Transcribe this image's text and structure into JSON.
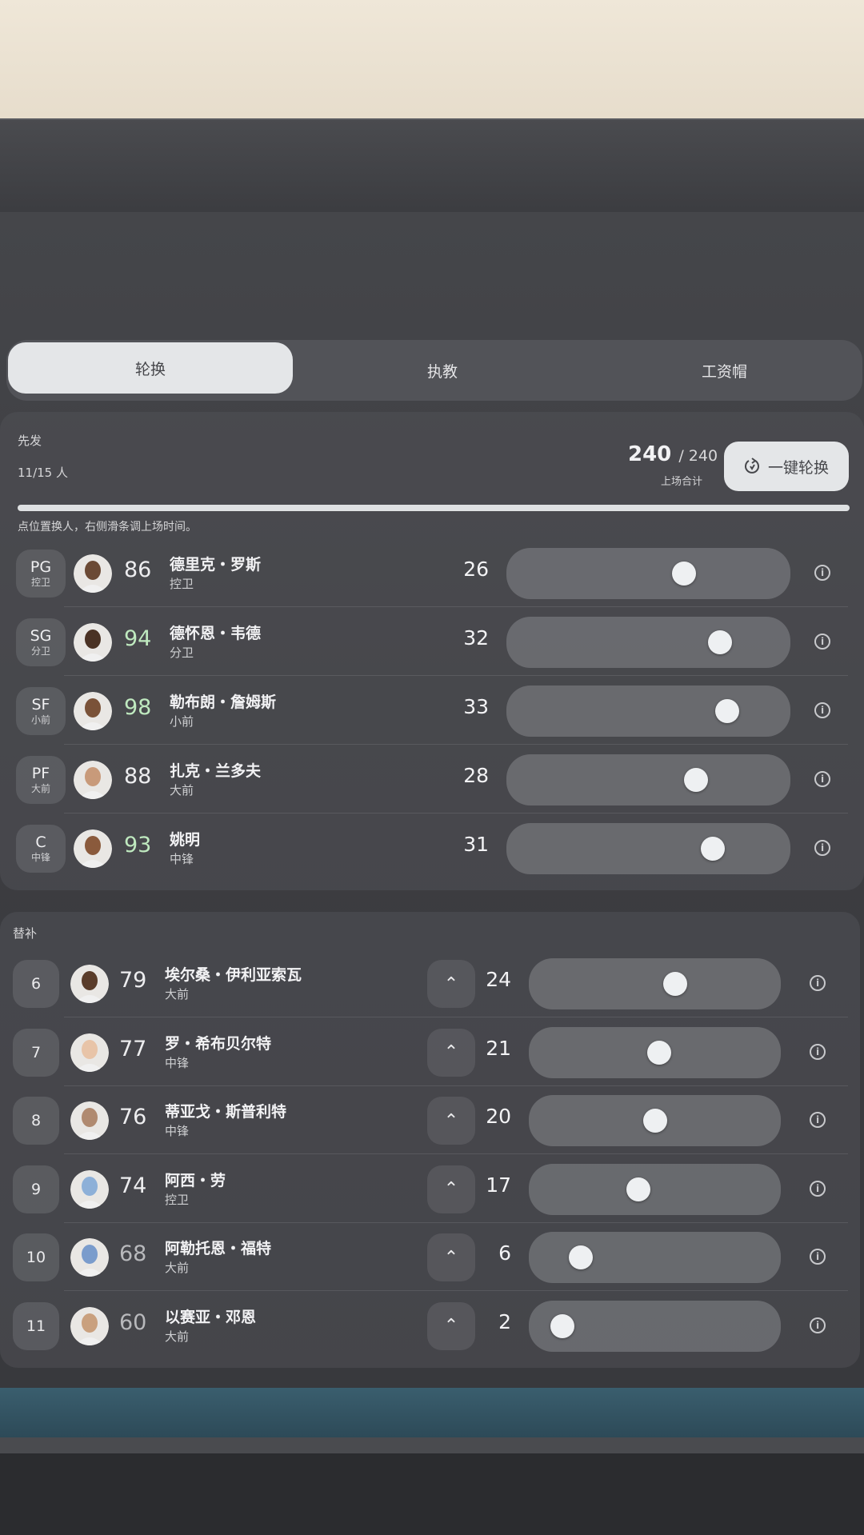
{
  "tabs": [
    {
      "label": "轮换"
    },
    {
      "label": "执教"
    },
    {
      "label": "工资帽"
    }
  ],
  "starters": {
    "title": "先发",
    "count": "11/15 人",
    "total_value": "240",
    "total_max": "/ 240",
    "total_label": "上场合计",
    "rotate_button": "一键轮换",
    "hint": "点位置换人，右侧滑条调上场时间。",
    "players": [
      {
        "pos": "PG",
        "pos_zh": "控卫",
        "ovr": "86",
        "name": "德里克・罗斯",
        "npos": "控卫",
        "mins": "26",
        "level": 0.65
      },
      {
        "pos": "SG",
        "pos_zh": "分卫",
        "ovr": "94",
        "name": "德怀恩・韦德",
        "npos": "分卫",
        "mins": "32",
        "level": 0.8
      },
      {
        "pos": "SF",
        "pos_zh": "小前",
        "ovr": "98",
        "name": "勒布朗・詹姆斯",
        "npos": "小前",
        "mins": "33",
        "level": 0.83
      },
      {
        "pos": "PF",
        "pos_zh": "大前",
        "ovr": "88",
        "name": "扎克・兰多夫",
        "npos": "大前",
        "mins": "28",
        "level": 0.7
      },
      {
        "pos": "C",
        "pos_zh": "中锋",
        "ovr": "93",
        "name": "姚明",
        "npos": "中锋",
        "mins": "31",
        "level": 0.77
      }
    ]
  },
  "bench": {
    "title": "替补",
    "players": [
      {
        "num": "6",
        "ovr": "79",
        "name": "埃尔桑・伊利亚索瓦",
        "npos": "大前",
        "mins": "24",
        "level": 0.6
      },
      {
        "num": "7",
        "ovr": "77",
        "name": "罗・希布贝尔特",
        "npos": "中锋",
        "mins": "21",
        "level": 0.52
      },
      {
        "num": "8",
        "ovr": "76",
        "name": "蒂亚戈・斯普利特",
        "npos": "中锋",
        "mins": "20",
        "level": 0.5
      },
      {
        "num": "9",
        "ovr": "74",
        "name": "阿西・劳",
        "npos": "控卫",
        "mins": "17",
        "level": 0.42
      },
      {
        "num": "10",
        "ovr": "68",
        "name": "阿勒托恩・福特",
        "npos": "大前",
        "mins": "6",
        "level": 0.14
      },
      {
        "num": "11",
        "ovr": "60",
        "name": "以赛亚・邓恩",
        "npos": "大前",
        "mins": "2",
        "level": 0.05
      }
    ]
  },
  "colors": {
    "high_rating": "#bfe9bf",
    "mid_rating": "#ededef",
    "low_rating": "#b8b9bc"
  },
  "icons": {
    "info": "info-icon",
    "up": "chevron-up-icon",
    "rotate": "rotate-icon"
  }
}
